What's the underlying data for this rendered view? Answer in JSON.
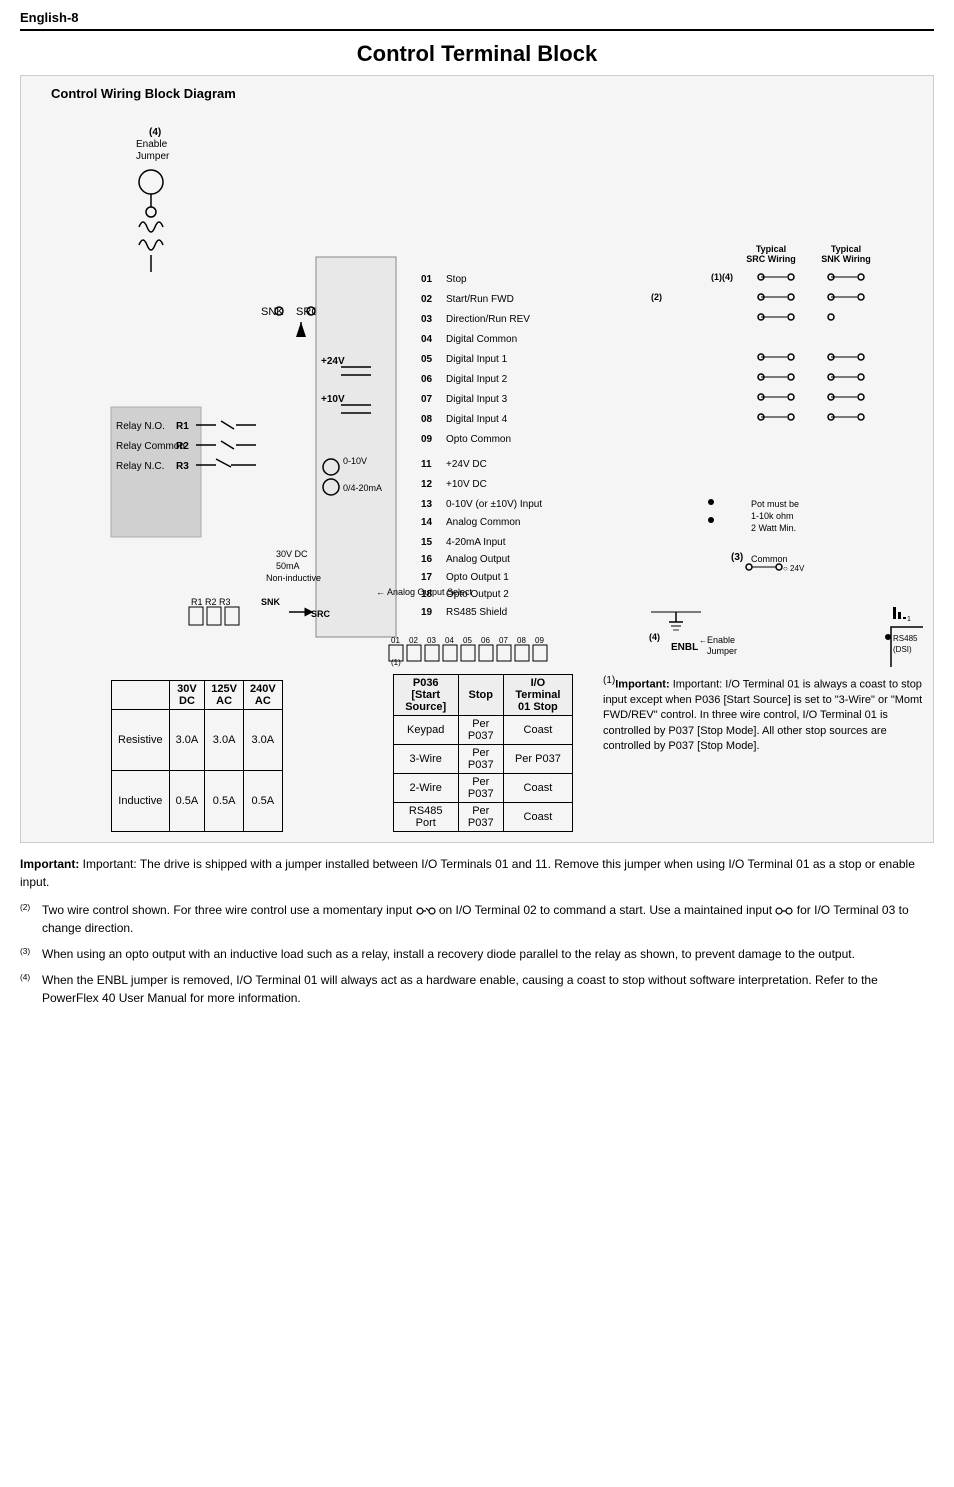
{
  "header": {
    "label": "English-8"
  },
  "page_title": "Control Terminal Block",
  "section_title": "Control Wiring Block Diagram",
  "diagram": {
    "terminals": {
      "left_labels": [
        {
          "id": "R1",
          "name": "Relay N.O."
        },
        {
          "id": "R2",
          "name": "Relay Common"
        },
        {
          "id": "R3",
          "name": "Relay N.C."
        }
      ],
      "right_labels": [
        {
          "num": "01",
          "name": "Stop (1)(4)"
        },
        {
          "num": "02",
          "name": "Start/Run FWD (2)"
        },
        {
          "num": "03",
          "name": "Direction/Run REV"
        },
        {
          "num": "04",
          "name": "Digital Common"
        },
        {
          "num": "05",
          "name": "Digital Input 1"
        },
        {
          "num": "06",
          "name": "Digital Input 2"
        },
        {
          "num": "07",
          "name": "Digital Input 3"
        },
        {
          "num": "08",
          "name": "Digital Input 4"
        },
        {
          "num": "09",
          "name": "Opto Common"
        },
        {
          "num": "11",
          "name": "+24V DC"
        },
        {
          "num": "12",
          "name": "+10V DC"
        },
        {
          "num": "13",
          "name": "0-10V (or ±10V) Input"
        },
        {
          "num": "14",
          "name": "Analog Common"
        },
        {
          "num": "15",
          "name": "4-20mA Input"
        },
        {
          "num": "16",
          "name": "Analog Output"
        },
        {
          "num": "17",
          "name": "Opto Output 1"
        },
        {
          "num": "18",
          "name": "Opto Output 2"
        },
        {
          "num": "19",
          "name": "RS485 Shield"
        }
      ]
    },
    "typical_src_wiring": "Typical SRC Wiring",
    "typical_snk_wiring": "Typical SNK Wiring",
    "labels": {
      "enable_jumper": "Enable Jumper",
      "snk": "SNK",
      "src": "SRC",
      "plus24v": "+24V",
      "plus10v": "+10V",
      "analog_out_select": "Analog Output Select",
      "range_0_10v": "0-10V",
      "range_0_20ma": "0/4-20mA",
      "range_30vdc": "30V DC",
      "range_50ma": "50mA",
      "non_inductive": "Non-inductive",
      "enbl": "ENBL",
      "enable_jumper_bottom": "Enable Jumper",
      "rs485_dsi": "RS485 (DSI)",
      "pot_note": "Pot must be 1-10k ohm 2 Watt Min.",
      "common_label": "Common",
      "annotation_3": "(3)",
      "annotation_1": "(1)",
      "annotation_4_top": "(4)",
      "annotation_4_bottom": "(4)"
    }
  },
  "current_ratings": {
    "headers": [
      "",
      "30V DC",
      "125V AC",
      "240V AC"
    ],
    "rows": [
      [
        "Resistive",
        "3.0A",
        "3.0A",
        "3.0A"
      ],
      [
        "Inductive",
        "0.5A",
        "0.5A",
        "0.5A"
      ]
    ]
  },
  "io_table": {
    "headers": [
      "P036 [Start Source]",
      "Stop",
      "I/O Terminal 01 Stop"
    ],
    "rows": [
      [
        "Keypad",
        "Per P037",
        "Coast"
      ],
      [
        "3-Wire",
        "Per P037",
        "Per P037"
      ],
      [
        "2-Wire",
        "Per P037",
        "Coast"
      ],
      [
        "RS485 Port",
        "Per P037",
        "Coast"
      ]
    ]
  },
  "notes": {
    "important_1_label": "(1)",
    "important_1": "Important: I/O Terminal 01 is always a coast to stop input except when P036 [Start Source] is set to \"3-Wire\" or \"Momt FWD/REV\" control. In three wire control, I/O Terminal 01 is controlled by P037 [Stop Mode]. All other stop sources are controlled by P037 [Stop Mode].",
    "important_main": "Important: The drive is shipped with a jumper installed between I/O Terminals 01 and 11. Remove this jumper when using I/O Terminal 01 as a stop or enable input.",
    "note_2_label": "(2)",
    "note_2": "Two wire control shown. For three wire control use a momentary input on I/O Terminal 02 to command a start. Use a maintained input for I/O Terminal 03 to change direction.",
    "note_3_label": "(3)",
    "note_3": "When using an opto output with an inductive load such as a relay, install a recovery diode parallel to the relay as shown, to prevent damage to the output.",
    "note_4_label": "(4)",
    "note_4": "When the ENBL jumper is removed, I/O Terminal 01 will always act as a hardware enable, causing a coast to stop without software interpretation. Refer to the PowerFlex 40 User Manual for more information."
  }
}
